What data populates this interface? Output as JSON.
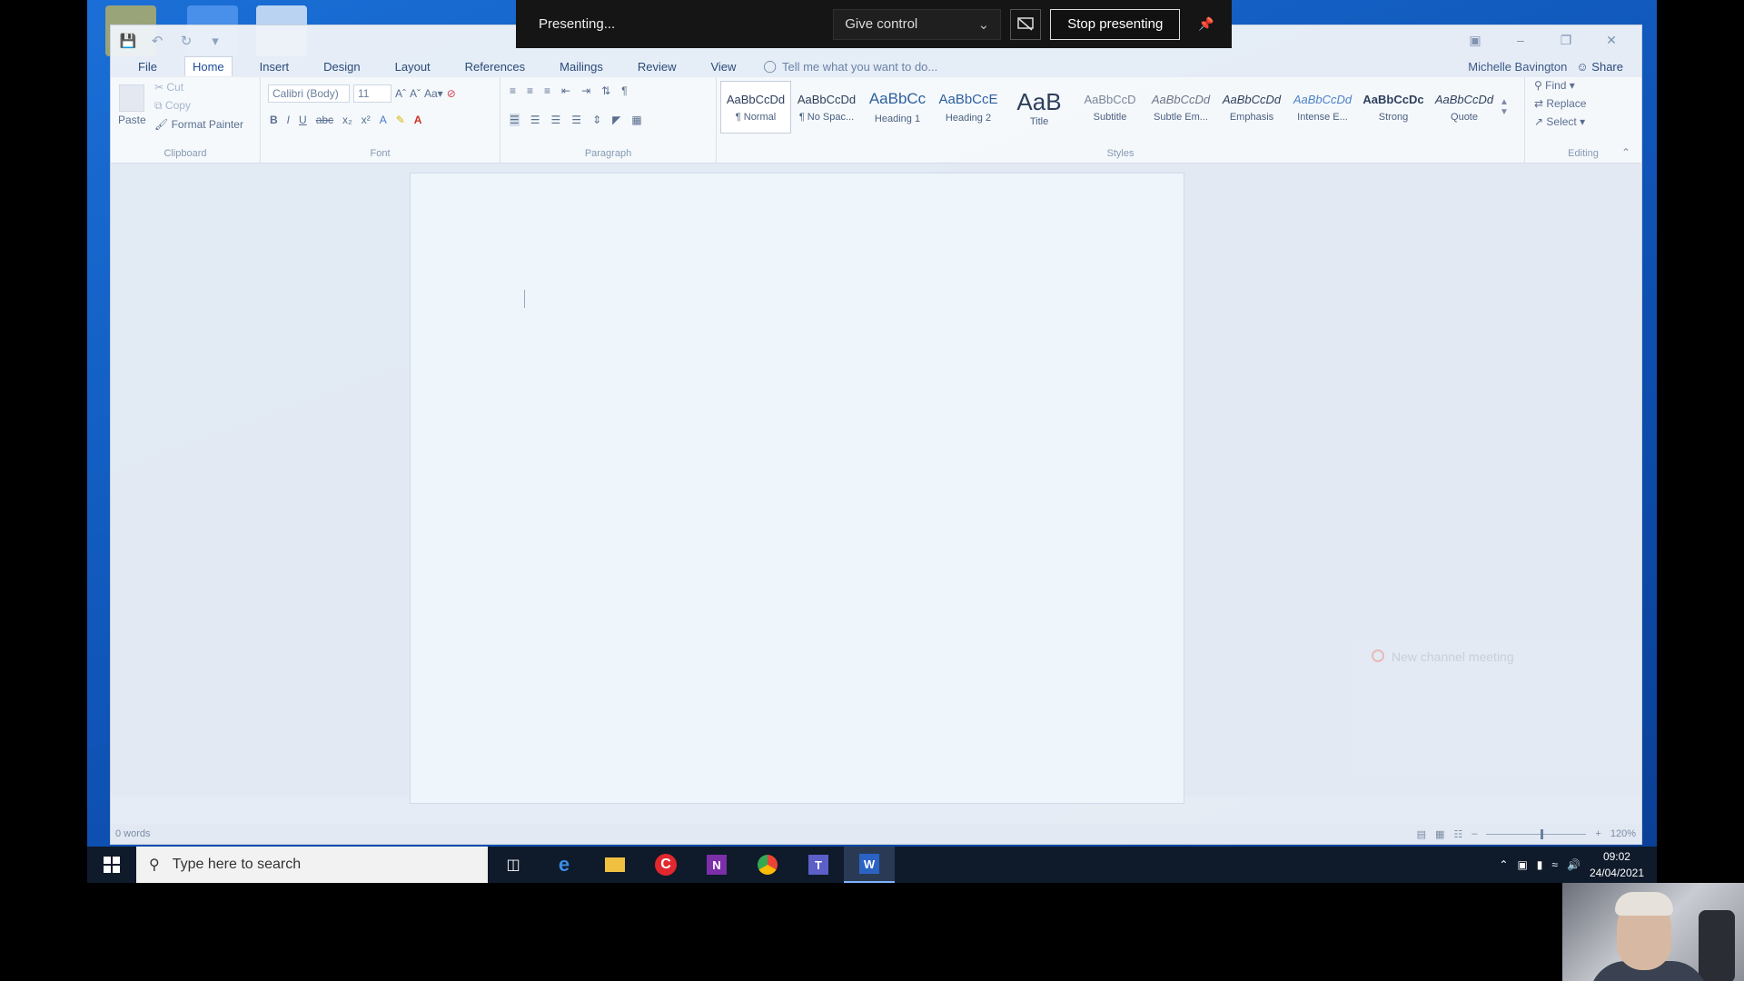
{
  "presenting": {
    "status": "Presenting...",
    "give_control": "Give control",
    "stop_presenting": "Stop presenting"
  },
  "word": {
    "menu": [
      "File",
      "Home",
      "Insert",
      "Design",
      "Layout",
      "References",
      "Mailings",
      "Review",
      "View"
    ],
    "active_menu": "Home",
    "tell_me": "Tell me what you want to do...",
    "user": "Michelle Bavington",
    "share": "Share",
    "clipboard": {
      "paste": "Paste",
      "cut": "Cut",
      "copy": "Copy",
      "format_painter": "Format Painter",
      "label": "Clipboard"
    },
    "font": {
      "name": "Calibri (Body)",
      "size": "11",
      "label": "Font"
    },
    "paragraph_label": "Paragraph",
    "styles": [
      {
        "sample": "AaBbCcDd",
        "name": "¶ Normal"
      },
      {
        "sample": "AaBbCcDd",
        "name": "¶ No Spac..."
      },
      {
        "sample": "AaBbCc",
        "name": "Heading 1"
      },
      {
        "sample": "AaBbCcE",
        "name": "Heading 2"
      },
      {
        "sample": "AaB",
        "name": "Title"
      },
      {
        "sample": "AaBbCcD",
        "name": "Subtitle"
      },
      {
        "sample": "AaBbCcDd",
        "name": "Subtle Em..."
      },
      {
        "sample": "AaBbCcDd",
        "name": "Emphasis"
      },
      {
        "sample": "AaBbCcDd",
        "name": "Intense E..."
      },
      {
        "sample": "AaBbCcDc",
        "name": "Strong"
      },
      {
        "sample": "AaBbCcDd",
        "name": "Quote"
      }
    ],
    "styles_label": "Styles",
    "editing": {
      "find": "Find",
      "replace": "Replace",
      "select": "Select",
      "label": "Editing"
    },
    "status_words": "0 words",
    "zoom": "120%"
  },
  "notification": {
    "title": "New channel meeting"
  },
  "taskbar": {
    "search_placeholder": "Type here to search",
    "time": "09:02",
    "date": "24/04/2021"
  }
}
